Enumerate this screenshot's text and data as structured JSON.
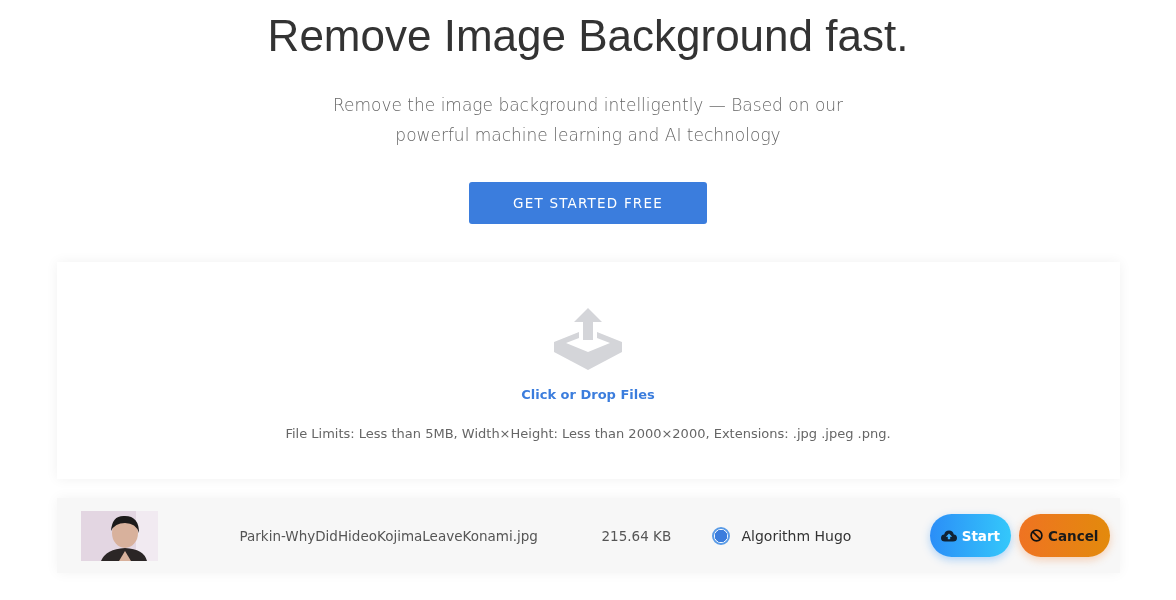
{
  "hero": {
    "title": "Remove Image Background fast.",
    "subtitle": "Remove the image background intelligently — Based on our powerful machine learning and AI technology",
    "cta": "GET STARTED FREE"
  },
  "upload": {
    "label": "Click or Drop Files",
    "limits": "File Limits: Less than 5MB, Width×Height: Less than 2000×2000, Extensions: .jpg .jpeg .png."
  },
  "files": [
    {
      "name": "Parkin-WhyDidHideoKojimaLeaveKonami.jpg",
      "size": "215.64 KB",
      "algorithm": {
        "label": "Algorithm Hugo",
        "selected": true
      },
      "actions": [
        {
          "kind": "start",
          "label": "Start"
        },
        {
          "kind": "cancel",
          "label": "Cancel"
        }
      ]
    }
  ]
}
